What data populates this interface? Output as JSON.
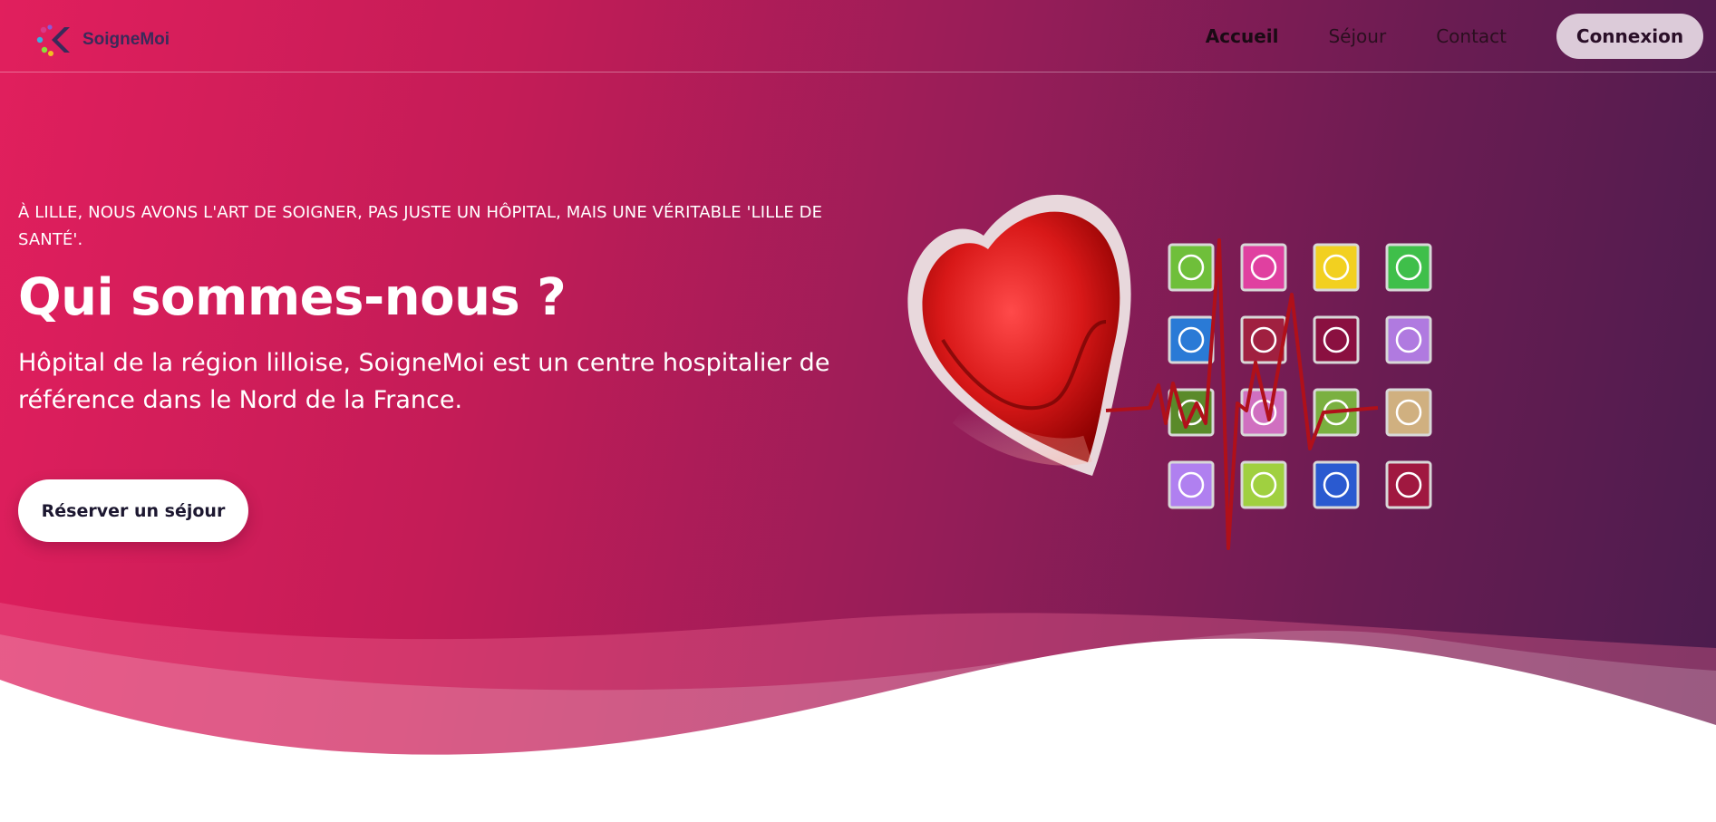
{
  "brand": {
    "name": "SoigneMoi",
    "colors": {
      "gradient_start": "#e11f5d",
      "gradient_end": "#4a1c4e",
      "logo_text": "#3a2a5a",
      "login_bg": "#dccbd9"
    }
  },
  "nav": {
    "links": [
      {
        "label": "Accueil",
        "active": true
      },
      {
        "label": "Séjour",
        "active": false
      },
      {
        "label": "Contact",
        "active": false
      }
    ],
    "login_label": "Connexion"
  },
  "hero": {
    "tagline": "À LILLE, NOUS AVONS L'ART DE SOIGNER, PAS JUSTE UN HÔPITAL, MAIS UNE VÉRITABLE 'LILLE DE SANTÉ'.",
    "title": "Qui sommes-nous ?",
    "description": "Hôpital de la région lilloise, SoigneMoi est un centre hospitalier de référence dans le Nord de la France.",
    "cta_label": "Réserver un séjour"
  },
  "illustration": {
    "icon": "heart-medical-icons-illustration",
    "tile_colors": [
      "#6fbf3a",
      "#e040a0",
      "#f2d020",
      "#3fbf4a",
      "#2a7ad6",
      "#a02040",
      "#8a1040",
      "#b07ae0",
      "#5a8a2a",
      "#d070c0",
      "#7ab040",
      "#d0b080",
      "#b080f0",
      "#a0d040",
      "#2a5ad0",
      "#a01840"
    ]
  }
}
